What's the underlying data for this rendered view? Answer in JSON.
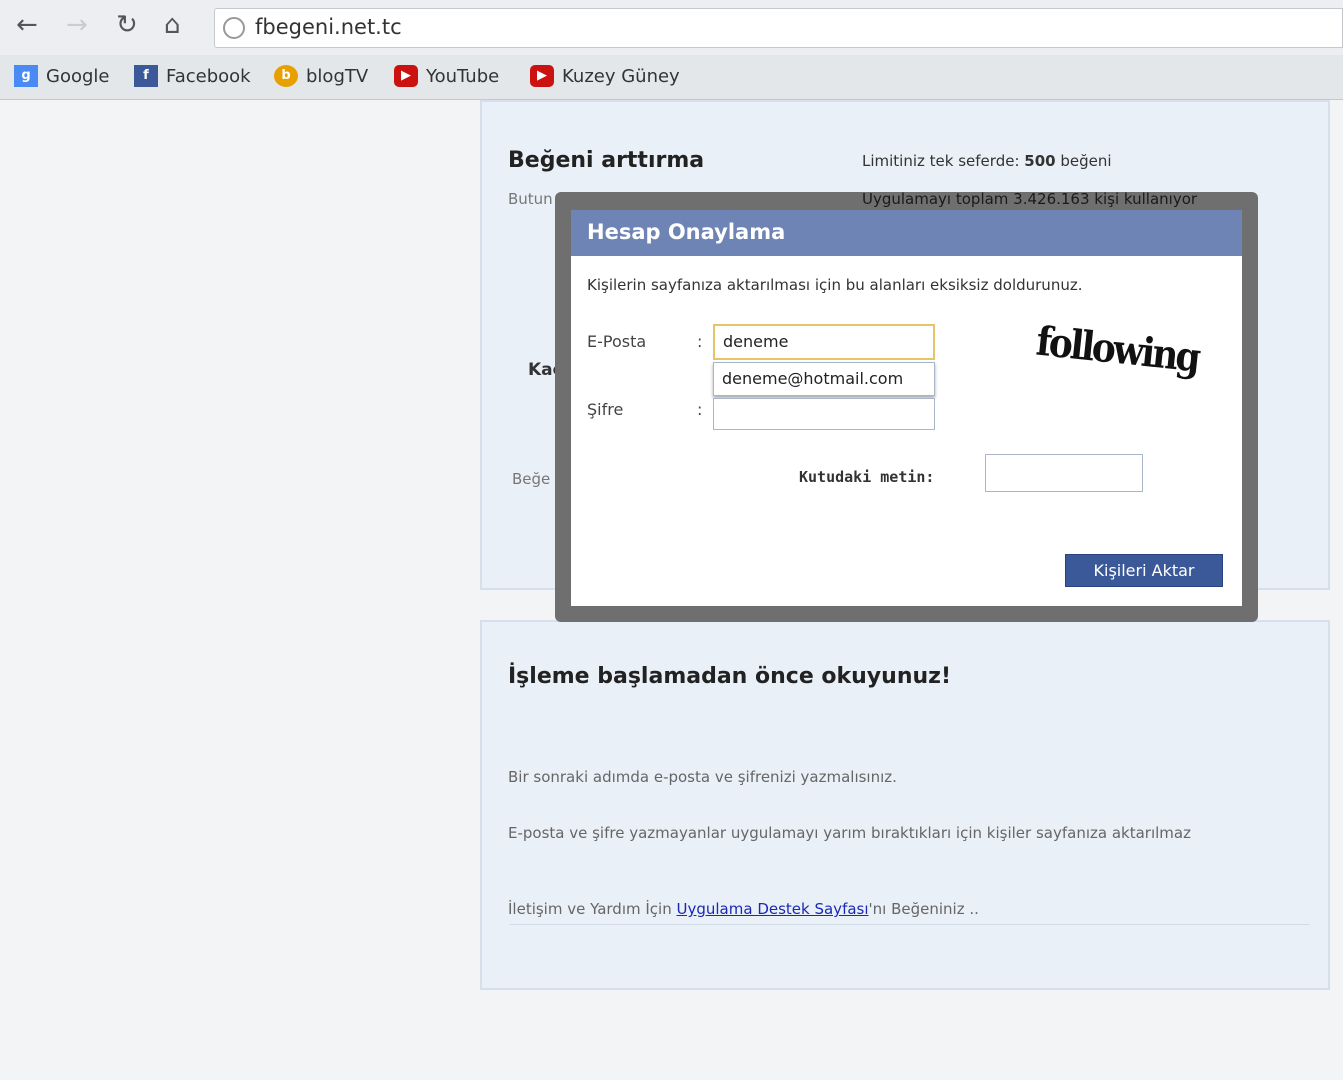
{
  "browser": {
    "url": "fbegeni.net.tc",
    "bookmarks": [
      {
        "label": "Google",
        "color": "#4a8af4"
      },
      {
        "label": "Facebook",
        "color": "#3b5998"
      },
      {
        "label": "blogTV",
        "color": "#e8a000"
      },
      {
        "label": "YouTube",
        "color": "#cc1111"
      },
      {
        "label": "Kuzey Güney",
        "color": "#cc1111"
      }
    ]
  },
  "panel1": {
    "title": "Beğeni arttırma",
    "limit_prefix": "Limitiniz tek seferde:",
    "limit_value": "500",
    "limit_suffix": "beğeni",
    "subtitle": "Butun",
    "users_text": "Uygulamayı toplam 3.426.163 kişi kullanıyor",
    "kac": "Kaç",
    "bege": "Beğe"
  },
  "modal": {
    "title": "Hesap Onaylama",
    "instruction": "Kişilerin sayfanıza aktarılması için bu alanları eksiksiz doldurunuz.",
    "email_label": "E-Posta",
    "colon": ":",
    "email_value": "deneme",
    "autocomplete": "deneme@hotmail.com",
    "password_label": "Şifre",
    "password_value": "",
    "captcha_text": "following",
    "captcha_label": "Kutudaki metin:",
    "captcha_value": "",
    "submit": "Kişileri Aktar"
  },
  "panel2": {
    "title": "İşleme başlamadan önce okuyunuz!",
    "p1": "Bir sonraki adımda e-posta ve şifrenizi yazmalısınız.",
    "p2": "E-posta ve şifre yazmayanlar uygulamayı yarım bıraktıkları için kişiler sayfanıza aktarılmaz",
    "p3_prefix": "İletişim ve Yardım İçin",
    "p3_link": "Uygulama Destek Sayfası",
    "p3_suffix": "'nı Beğeniniz .."
  }
}
